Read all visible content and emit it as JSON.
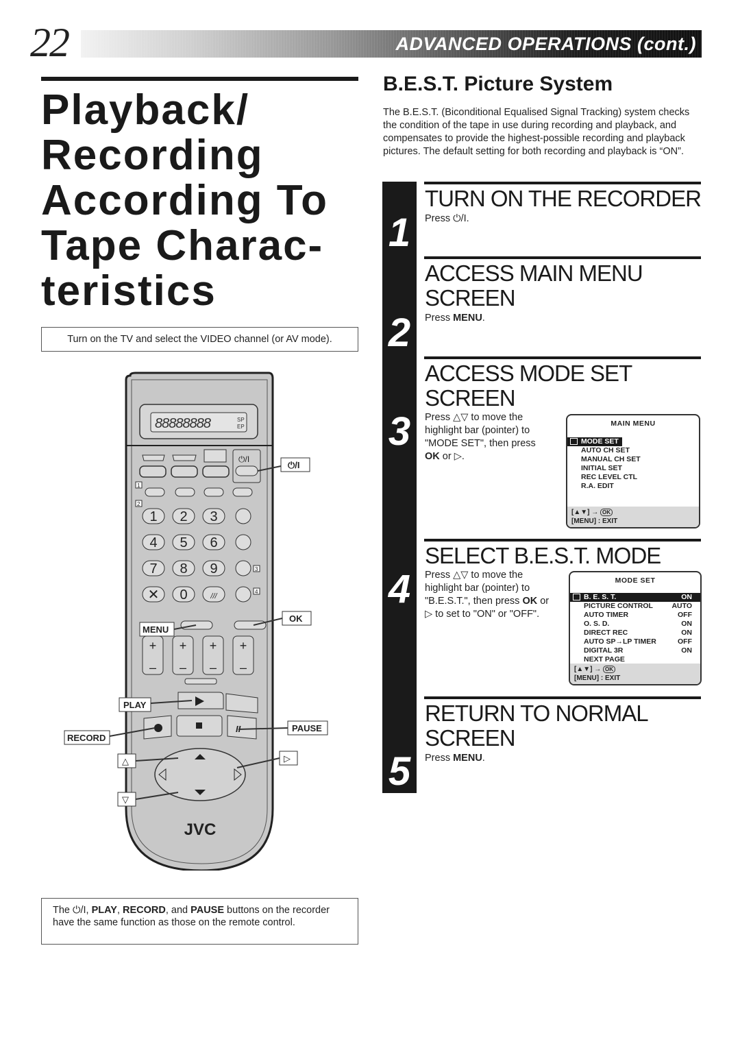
{
  "header": {
    "page_number": "22",
    "section_title": "ADVANCED OPERATIONS (cont.)"
  },
  "left": {
    "title_lines": [
      "Playback/",
      "Recording",
      "According To",
      "Tape Charac-",
      "teristics"
    ],
    "tv_note": "Turn on the TV and select the VIDEO channel (or AV mode).",
    "remote": {
      "brand": "JVC",
      "display_indicators": [
        "SP",
        "EP"
      ],
      "callouts": {
        "power": "⏻/I",
        "menu": "MENU",
        "ok": "OK",
        "play": "PLAY",
        "record": "RECORD",
        "pause": "PAUSE",
        "up": "△",
        "down": "▽",
        "right": "▷"
      },
      "keypad": [
        "1",
        "2",
        "3",
        "4",
        "5",
        "6",
        "7",
        "8",
        "9",
        "0"
      ],
      "side_labels": [
        "1",
        "2",
        "3",
        "4"
      ]
    },
    "bottom_note": {
      "prefix": "The ",
      "power_symbol": "⏻/I",
      "sep1": ", ",
      "play": "PLAY",
      "sep2": ", ",
      "record": "RECORD",
      "sep3": ", and ",
      "pause": "PAUSE",
      "suffix": " buttons on the recorder have the same function as those on the remote control."
    }
  },
  "right": {
    "best_title": "B.E.S.T. Picture System",
    "best_description": "The B.E.S.T. (Biconditional Equalised Signal Tracking) system checks the condition of the tape in use during recording and playback, and compensates to provide the highest-possible recording and playback pictures. The default setting for both recording and playback is “ON”.",
    "steps": [
      {
        "number": "1",
        "heading": "TURN ON THE RECORDER",
        "text_prefix": "Press ",
        "text_bold": "⏻/I",
        "text_suffix": "."
      },
      {
        "number": "2",
        "heading": "ACCESS MAIN MENU SCREEN",
        "text_prefix": "Press ",
        "text_bold": "MENU",
        "text_suffix": "."
      },
      {
        "number": "3",
        "heading": "ACCESS MODE SET SCREEN",
        "text_prefix": "Press △▽ to move the highlight bar (pointer) to \"MODE SET\", then press ",
        "text_bold": "OK",
        "text_suffix": " or ▷."
      },
      {
        "number": "4",
        "heading": "SELECT B.E.S.T. MODE",
        "text_prefix": "Press △▽ to move the highlight bar (pointer) to \"B.E.S.T.\", then press ",
        "text_bold": "OK",
        "text_suffix": " or ▷ to set to \"ON\" or \"OFF\"."
      },
      {
        "number": "5",
        "heading": "RETURN TO NORMAL SCREEN",
        "text_prefix": "Press ",
        "text_bold": "MENU",
        "text_suffix": "."
      }
    ],
    "main_menu_screen": {
      "title": "MAIN MENU",
      "items": [
        "MODE SET",
        "AUTO CH SET",
        "MANUAL CH SET",
        "INITIAL SET",
        "REC LEVEL CTL",
        "R.A. EDIT"
      ],
      "selected_index": 0,
      "footer_nav": "[▲▼] →",
      "footer_ok": "OK",
      "footer_exit": "[MENU] : EXIT"
    },
    "mode_set_screen": {
      "title": "MODE SET",
      "items": [
        {
          "label": "B. E. S. T.",
          "value": "ON"
        },
        {
          "label": "PICTURE CONTROL",
          "value": "AUTO"
        },
        {
          "label": "AUTO TIMER",
          "value": "OFF"
        },
        {
          "label": "O. S. D.",
          "value": "ON"
        },
        {
          "label": "DIRECT REC",
          "value": "ON"
        },
        {
          "label": "AUTO SP→LP TIMER",
          "value": "OFF"
        },
        {
          "label": "DIGITAL 3R",
          "value": "ON"
        },
        {
          "label": "NEXT PAGE",
          "value": ""
        }
      ],
      "selected_index": 0,
      "footer_nav": "[▲▼] →",
      "footer_ok": "OK",
      "footer_exit": "[MENU] : EXIT"
    }
  }
}
